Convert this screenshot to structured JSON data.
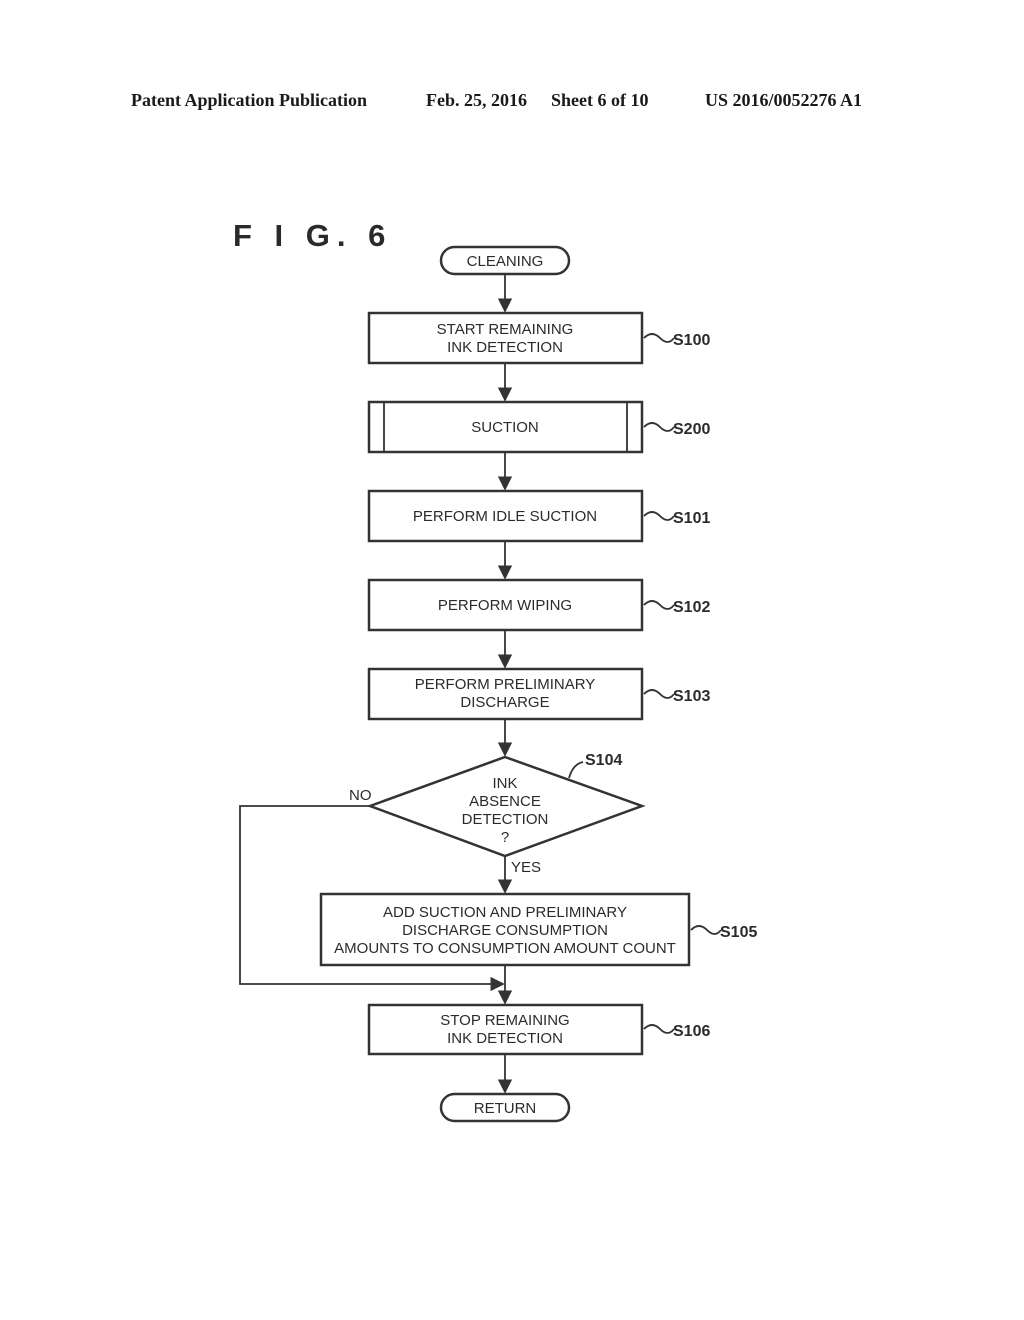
{
  "header": {
    "publication": "Patent Application Publication",
    "date": "Feb. 25, 2016",
    "sheet": "Sheet 6 of 10",
    "number": "US 2016/0052276 A1"
  },
  "figure": {
    "title": "F I G.  6"
  },
  "flowchart": {
    "start": "CLEANING",
    "end": "RETURN",
    "steps": [
      {
        "id": "S100",
        "lines": [
          "START REMAINING",
          "INK DETECTION"
        ]
      },
      {
        "id": "S200",
        "lines": [
          "SUCTION"
        ],
        "type": "subroutine"
      },
      {
        "id": "S101",
        "lines": [
          "PERFORM IDLE SUCTION"
        ]
      },
      {
        "id": "S102",
        "lines": [
          "PERFORM WIPING"
        ]
      },
      {
        "id": "S103",
        "lines": [
          "PERFORM PRELIMINARY",
          "DISCHARGE"
        ]
      },
      {
        "id": "S104",
        "lines": [
          "INK",
          "ABSENCE",
          "DETECTION",
          "?"
        ],
        "type": "decision",
        "yes": "YES",
        "no": "NO"
      },
      {
        "id": "S105",
        "lines": [
          "ADD SUCTION AND PRELIMINARY",
          "DISCHARGE CONSUMPTION",
          "AMOUNTS TO CONSUMPTION AMOUNT COUNT"
        ]
      },
      {
        "id": "S106",
        "lines": [
          "STOP REMAINING",
          "INK DETECTION"
        ]
      }
    ]
  }
}
